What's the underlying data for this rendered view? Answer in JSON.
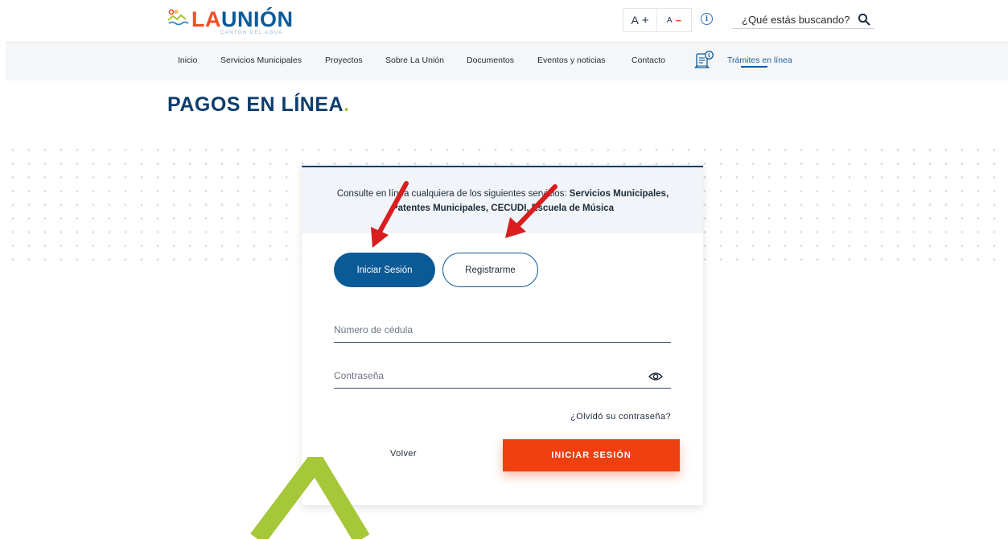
{
  "header": {
    "logo_text": "LAUNIÓN",
    "logo_subtitle": "CANTÓN DEL AGUA",
    "font_increase_label": "A",
    "font_increase_op": "+",
    "font_decrease_label": "A",
    "font_decrease_op": "−",
    "info_icon": "info-icon",
    "search_placeholder": "¿Qué estás buscando?",
    "search_icon": "search-icon"
  },
  "nav": {
    "items": [
      {
        "label": "Inicio"
      },
      {
        "label": "Servicios Municipales"
      },
      {
        "label": "Proyectos"
      },
      {
        "label": "Sobre La Unión"
      },
      {
        "label": "Documentos"
      },
      {
        "label": "Eventos y noticias"
      },
      {
        "label": "Contacto"
      }
    ],
    "tramites_label": "Trámites en línea",
    "tramites_icon": "document-payment-icon",
    "active_item": "Trámites en línea"
  },
  "page": {
    "title": "PAGOS EN LÍNEA",
    "title_dot": "."
  },
  "card": {
    "info_prefix": "Consulte en línea cualquiera de los siguientes servicios: ",
    "info_services": "Servicios Municipales, Patentes Municipales, CECUDI, Escuela de Música",
    "tab_login": "Iniciar Sesión",
    "tab_register": "Registrarme",
    "active_tab": "Iniciar Sesión",
    "cedula_placeholder": "Número de cédula",
    "password_placeholder": "Contraseña",
    "password_toggle_icon": "eye-icon",
    "forgot_link": "¿Olvidó su contraseña?",
    "back_link": "Volver",
    "submit_button": "INICIAR SESIÓN"
  },
  "colors": {
    "brand_blue": "#0b5a98",
    "dark_navy": "#0d3d6b",
    "accent_orange": "#f0400f",
    "accent_green": "#a5c738",
    "annotation_red": "#d81e1e"
  }
}
